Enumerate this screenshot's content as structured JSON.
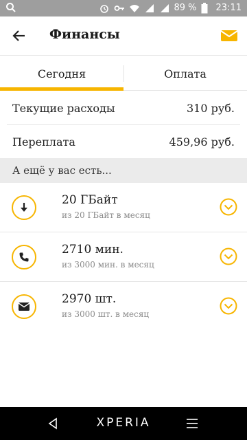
{
  "status_bar": {
    "battery": "89 %",
    "time": "23:11"
  },
  "app_bar": {
    "title": "Финансы"
  },
  "tabs": [
    {
      "label": "Сегодня",
      "active": true
    },
    {
      "label": "Оплата",
      "active": false
    }
  ],
  "balance": [
    {
      "label": "Текущие расходы",
      "value": "310 руб."
    },
    {
      "label": "Переплата",
      "value": "459,96 руб."
    }
  ],
  "section_title": "А ещё у вас есть...",
  "packages": [
    {
      "icon": "download-icon",
      "amount": "20 ГБайт",
      "limit": "из 20 ГБайт в месяц"
    },
    {
      "icon": "phone-icon",
      "amount": "2710 мин.",
      "limit": "из 3000 мин. в месяц"
    },
    {
      "icon": "envelope-icon",
      "amount": "2970 шт.",
      "limit": "из 3000 шт. в месяц"
    }
  ],
  "nav_bar": {
    "brand": "XPERIA"
  },
  "colors": {
    "accent": "#f7b500",
    "status_bar": "#9e9e9e",
    "section_bg": "#ebebeb"
  }
}
